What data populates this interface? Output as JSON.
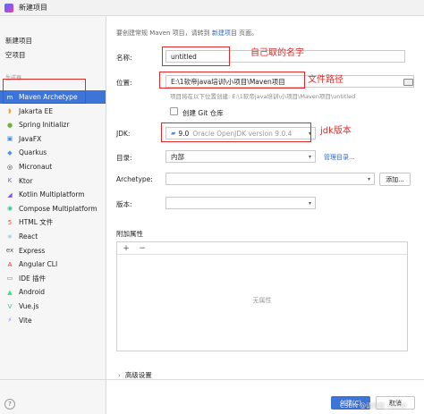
{
  "window": {
    "title": "新建项目"
  },
  "sidebar": {
    "top_items": [
      {
        "label": "新建项目"
      },
      {
        "label": "空项目"
      }
    ],
    "section_header": "生成器",
    "generators": [
      {
        "label": "Maven Archetype",
        "icon": "maven-icon",
        "color": "#7a5fd6",
        "glyph": "m",
        "selected": true
      },
      {
        "label": "Jakarta EE",
        "icon": "jakarta-icon",
        "color": "#f0a030",
        "glyph": "◗"
      },
      {
        "label": "Spring Initializr",
        "icon": "spring-icon",
        "color": "#6db33f",
        "glyph": "●"
      },
      {
        "label": "JavaFX",
        "icon": "javafx-icon",
        "color": "#4c8fd6",
        "glyph": "▣"
      },
      {
        "label": "Quarkus",
        "icon": "quarkus-icon",
        "color": "#4695eb",
        "glyph": "◆"
      },
      {
        "label": "Micronaut",
        "icon": "micronaut-icon",
        "color": "#333333",
        "glyph": "◎"
      },
      {
        "label": "Ktor",
        "icon": "ktor-icon",
        "color": "#8a4ee8",
        "glyph": "K"
      },
      {
        "label": "Kotlin Multiplatform",
        "icon": "kotlin-icon",
        "color": "#8a4ee8",
        "glyph": "◢"
      },
      {
        "label": "Compose Multiplatform",
        "icon": "compose-icon",
        "color": "#3ac48a",
        "glyph": "◉"
      },
      {
        "label": "HTML 文件",
        "icon": "html5-icon",
        "color": "#e34c26",
        "glyph": "5"
      },
      {
        "label": "React",
        "icon": "react-icon",
        "color": "#35b8d6",
        "glyph": "⚛"
      },
      {
        "label": "Express",
        "icon": "express-icon",
        "color": "#555555",
        "glyph": "ex"
      },
      {
        "label": "Angular CLI",
        "icon": "angular-icon",
        "color": "#d32f2f",
        "glyph": "A"
      },
      {
        "label": "IDE 插件",
        "icon": "plugin-icon",
        "color": "#777777",
        "glyph": "▭"
      },
      {
        "label": "Android",
        "icon": "android-icon",
        "color": "#3ddc84",
        "glyph": "▲"
      },
      {
        "label": "Vue.js",
        "icon": "vue-icon",
        "color": "#41b883",
        "glyph": "V"
      },
      {
        "label": "Vite",
        "icon": "vite-icon",
        "color": "#9c6bff",
        "glyph": "⚡"
      }
    ]
  },
  "main": {
    "hint_prefix": "要创建常规 Maven 项目，请转到",
    "hint_link": "新建项目",
    "hint_suffix": "页面。",
    "name_label": "名称:",
    "name_value": "untitled",
    "location_label": "位置:",
    "location_value": "E:\\1软帝java培训\\小项目\\Maven项目",
    "location_hint": "项目将在以下位置创建: E:\\1软帝java培训\\小项目\\Maven项目\\untitled",
    "git_label": "创建 Git 仓库",
    "jdk_label": "JDK:",
    "jdk_version": "9.0",
    "jdk_name": "Oracle OpenJDK version 9.0.4",
    "catalog_label": "目录:",
    "catalog_value": "内部",
    "manage_catalog": "管理目录...",
    "archetype_label": "Archetype:",
    "add_button": "添加...",
    "version_label": "版本:",
    "props_label": "附加属性",
    "add_prop": "+",
    "remove_prop": "−",
    "no_props": "无属性",
    "advanced_label": "高级设置",
    "create_button": "创建(C)",
    "cancel_button": "取消"
  },
  "annotations": {
    "name_note": "自己取的名字",
    "path_note": "文件路径",
    "jdk_note": "jdk版本"
  },
  "watermark": "CSDN @请赐教_IN130",
  "colors": {
    "accent": "#3d74d8",
    "annotation": "#e02a2a",
    "link": "#2f6ad0"
  }
}
